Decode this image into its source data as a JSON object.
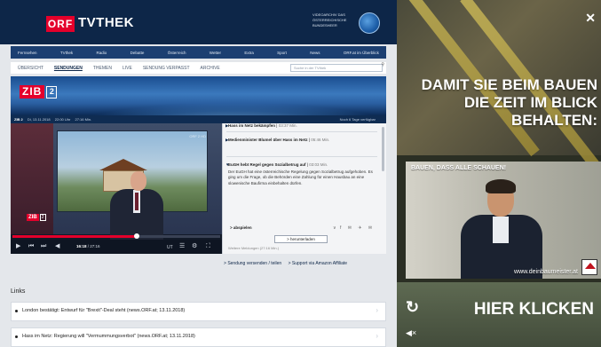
{
  "header": {
    "logo": "ORF",
    "title": "TVTHEK",
    "badge": "VIDEOARCHIV DAS ÖSTERREICHISCHE BUNDESHEER"
  },
  "main_nav": [
    "Fernsehen",
    "TVthek",
    "Radio",
    "Debatte",
    "Österreich",
    "Wetter",
    "Extra",
    "Sport",
    "News",
    "ORF.at im Überblick"
  ],
  "sub_nav": {
    "items": [
      "ÜBERSICHT",
      "SENDUNGEN",
      "THEMEN",
      "LIVE",
      "SENDUNG VERPASST",
      "ARCHIVE"
    ],
    "active": "SENDUNGEN",
    "search_placeholder": "Suche in der TVthek"
  },
  "show": {
    "logo_word": "ZIB",
    "logo_number": "2",
    "name": "ZIB 2",
    "date": "Di, 13.11.2018",
    "time": "22:00 Uhr",
    "duration": "27:16 Min.",
    "availability": "Noch 6 Tage verfügbar"
  },
  "player": {
    "elapsed": "16:18",
    "total": "27:16",
    "progress": 0.6,
    "channel_watermark": "ORF 2 HD",
    "control_labels": [
      "UT"
    ]
  },
  "chapters": [
    {
      "title": "Hass im Netz bekämpfen",
      "time": "03:37 Min."
    },
    {
      "title": "Medienminister Blumel über Hass im Netz",
      "time": "05:46 Min."
    },
    {
      "title": "EuGH hebt Regel gegen Sozialbetrug auf",
      "time": "03:03 Min.",
      "body": "Der EuGH hat eine österreichische Regelung gegen Sozialbetrug aufgehoben. Es ging um die Frage, ob die Behörden eine Zahlung für einen Hausbau an eine slowenische Baufirma einbehalten dürfen."
    }
  ],
  "share_label": "abspielen",
  "download_label": "herunterladen",
  "next_chapter": "Weitere Meldungen (27:16 Min.)",
  "footer_links": [
    "Sendung versenden / teilen",
    "Support via Amazon Affiliate"
  ],
  "links_heading": "Links",
  "links": [
    "London bestätigt: Entwurf für \"Brexit\"-Deal steht (news.ORF.at; 13.11.2018)",
    "Hass im Netz: Regierung will \"Vermummungsverbot\" (news.ORF.at; 13.11.2018)"
  ],
  "ad": {
    "headline": "DAMIT SIE BEIM BAUEN DIE ZEIT IM BLICK BEHALTEN:",
    "photo_tagline": "BAUEN, DASS ALLE SCHAUEN!",
    "url": "www.deinbaumeister.at",
    "cta": "HIER KLICKEN",
    "accent": "#d6c25a"
  }
}
